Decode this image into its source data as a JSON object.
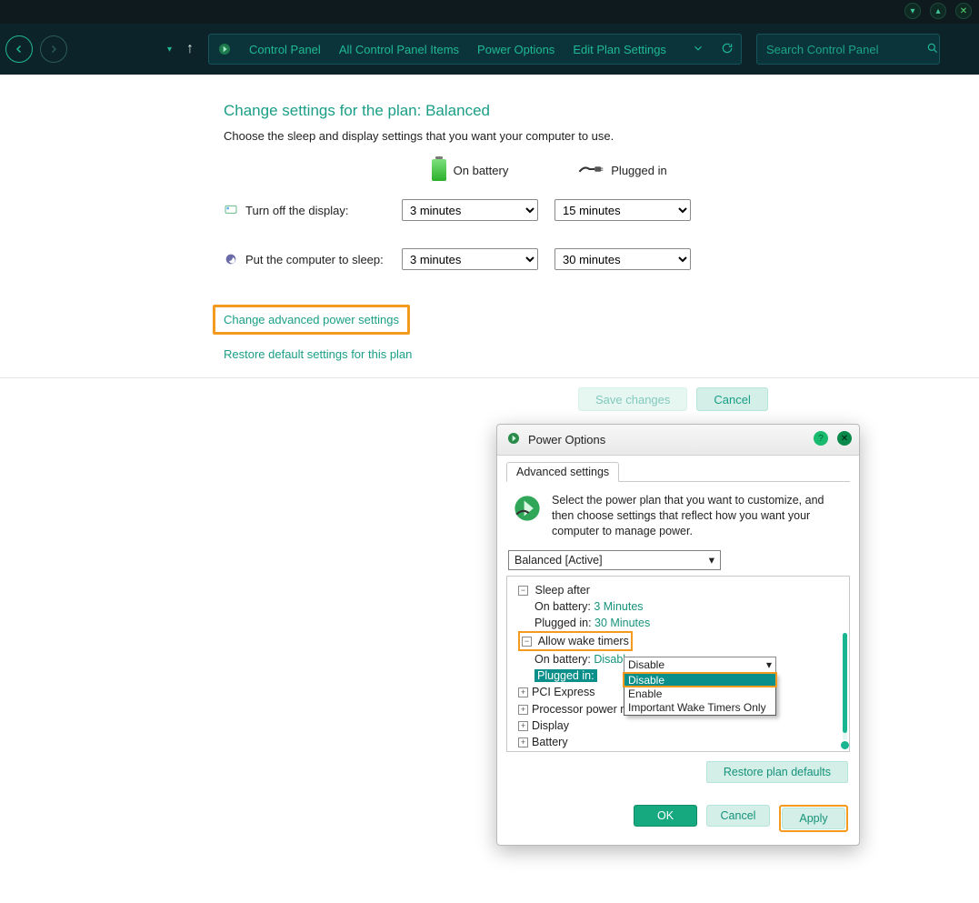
{
  "titlebar": {},
  "toolbar": {
    "breadcrumbs": [
      "Control Panel",
      "All Control Panel Items",
      "Power Options",
      "Edit Plan Settings"
    ],
    "search_placeholder": "Search Control Panel"
  },
  "page": {
    "title": "Change settings for the plan: Balanced",
    "subtitle": "Choose the sleep and display settings that you want your computer to use.",
    "col_battery": "On battery",
    "col_plugged": "Plugged in",
    "row_display": "Turn off the display:",
    "row_sleep": "Put the computer to sleep:",
    "display_battery": "3 minutes",
    "display_plugged": "15 minutes",
    "sleep_battery": "3 minutes",
    "sleep_plugged": "30 minutes",
    "link_advanced": "Change advanced power settings",
    "link_restore": "Restore default settings for this plan",
    "btn_save": "Save changes",
    "btn_cancel": "Cancel"
  },
  "dialog": {
    "title": "Power Options",
    "tab": "Advanced settings",
    "intro": "Select the power plan that you want to customize, and then choose settings that reflect how you want your computer to manage power.",
    "plan": "Balanced [Active]",
    "tree": {
      "sleep_after": "Sleep after",
      "sleep_battery_label": "On battery:",
      "sleep_battery_value": "3 Minutes",
      "sleep_plugged_label": "Plugged in:",
      "sleep_plugged_value": "30 Minutes",
      "wake": "Allow wake timers",
      "wake_battery_label": "On battery:",
      "wake_battery_value": "Disable",
      "wake_plugged_label": "Plugged in:",
      "wake_plugged_value": "Disable",
      "dd_opts": [
        "Disable",
        "Enable",
        "Important Wake Timers Only"
      ],
      "pci": "PCI Express",
      "proc": "Processor power m",
      "display": "Display",
      "battery": "Battery"
    },
    "restore": "Restore plan defaults",
    "ok": "OK",
    "cancel": "Cancel",
    "apply": "Apply"
  }
}
